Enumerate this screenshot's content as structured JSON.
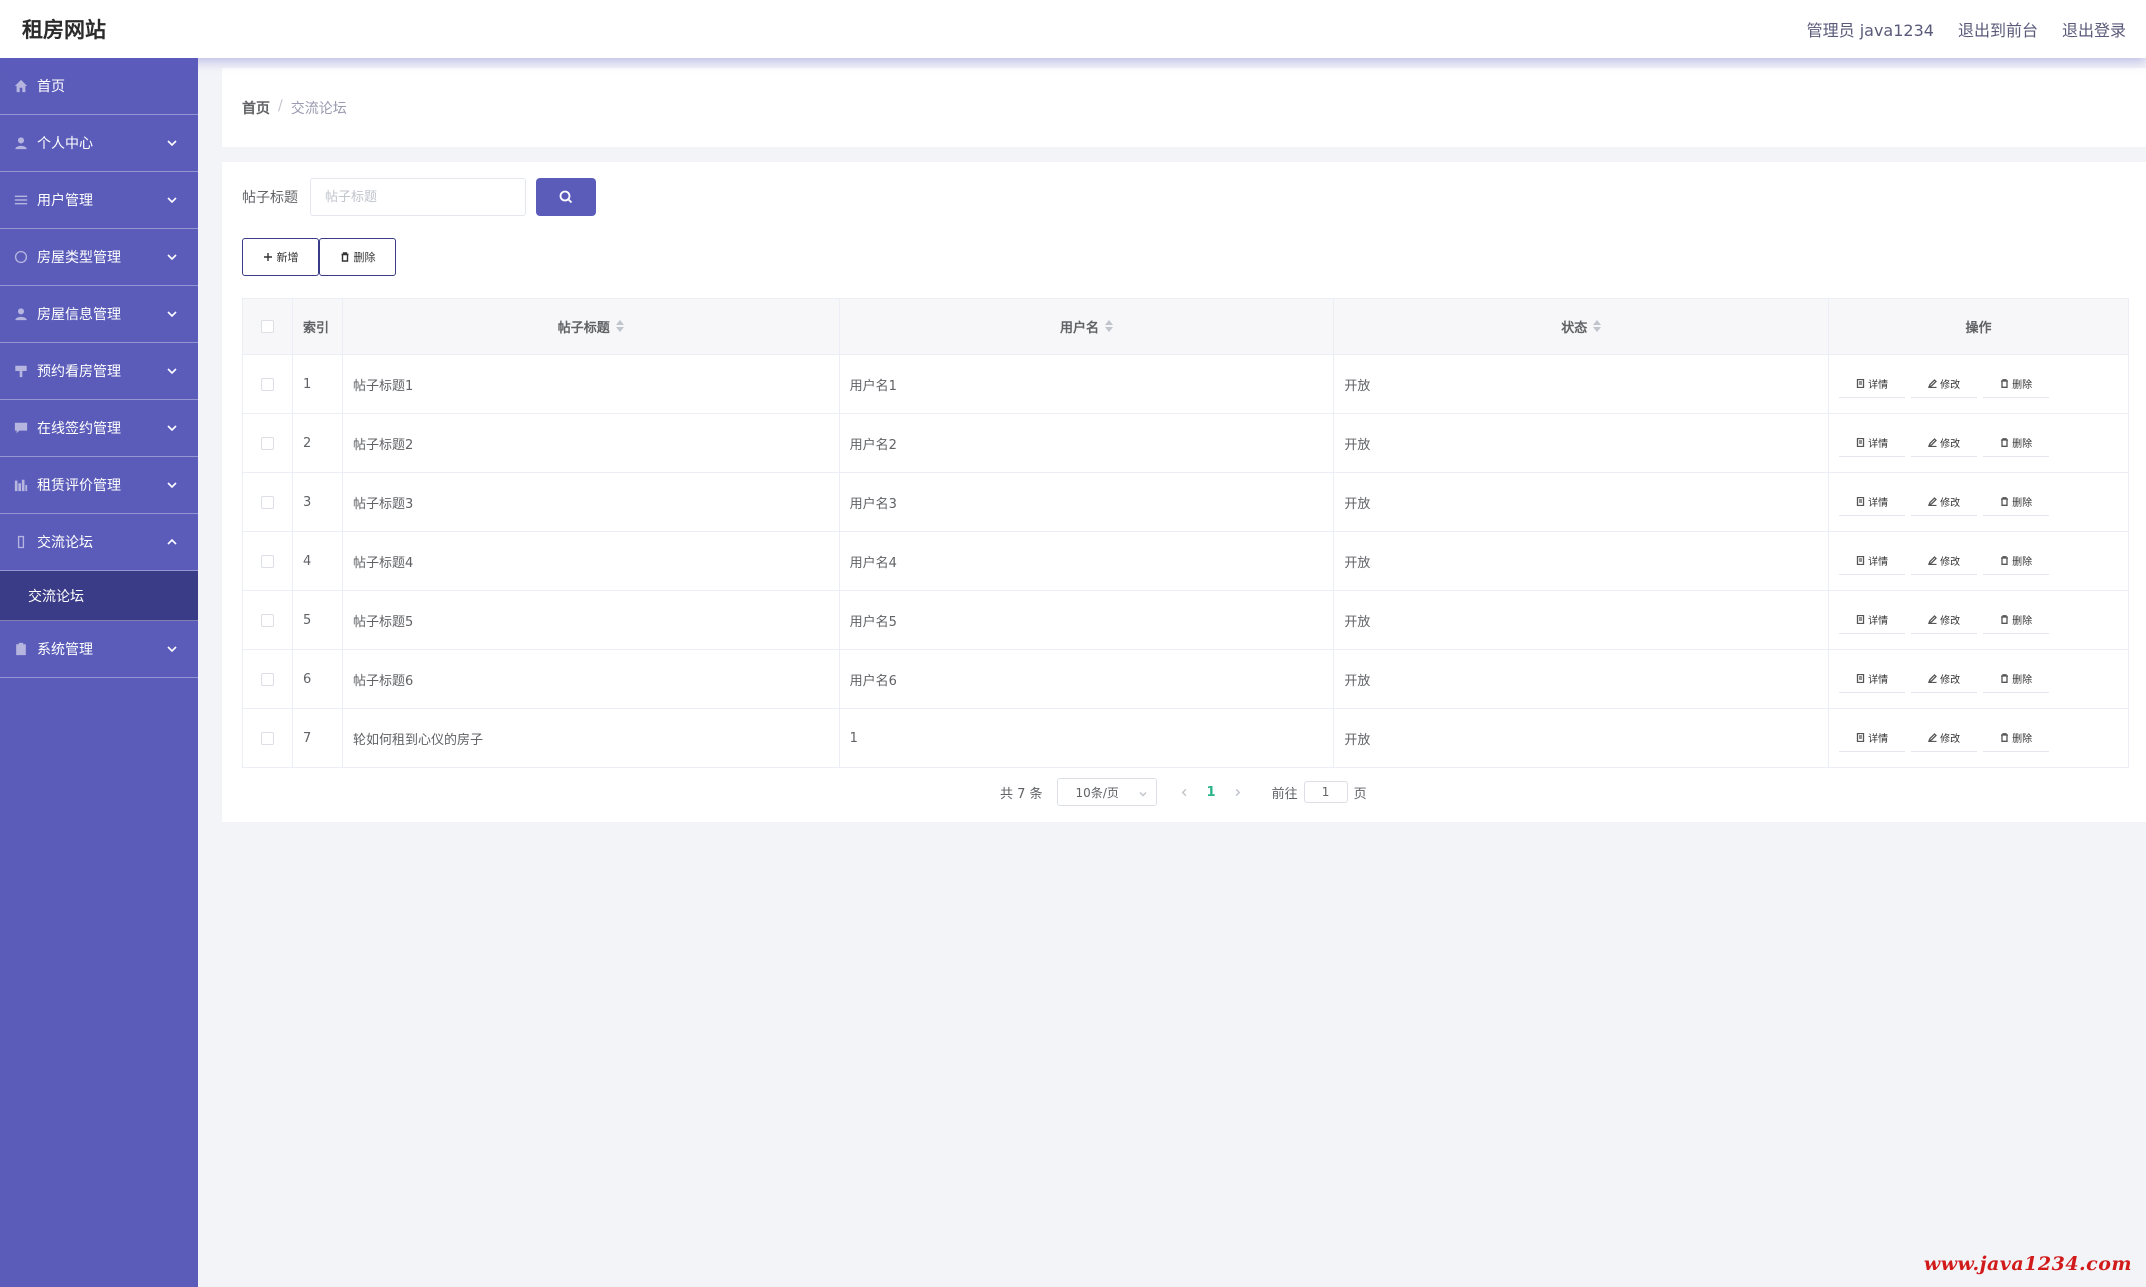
{
  "header": {
    "title": "租房网站",
    "admin_label": "管理员 java1234",
    "front_link": "退出到前台",
    "logout_link": "退出登录"
  },
  "sidebar": {
    "items": [
      {
        "label": "首页",
        "icon": "home-icon"
      },
      {
        "label": "个人中心",
        "icon": "user-icon"
      },
      {
        "label": "用户管理",
        "icon": "sliders-icon"
      },
      {
        "label": "房屋类型管理",
        "icon": "globe-icon"
      },
      {
        "label": "房屋信息管理",
        "icon": "user-icon"
      },
      {
        "label": "预约看房管理",
        "icon": "stand-icon"
      },
      {
        "label": "在线签约管理",
        "icon": "message-icon"
      },
      {
        "label": "租赁评价管理",
        "icon": "chart-icon"
      },
      {
        "label": "交流论坛",
        "icon": "phone-icon"
      },
      {
        "label": "系统管理",
        "icon": "clipboard-icon"
      }
    ],
    "active_sub": "交流论坛"
  },
  "breadcrumb": {
    "home": "首页",
    "separator": "/",
    "current": "交流论坛"
  },
  "search": {
    "label": "帖子标题",
    "placeholder": "帖子标题"
  },
  "actions": {
    "add_label": "新增",
    "delete_label": "删除"
  },
  "table": {
    "headers": {
      "index": "索引",
      "title": "帖子标题",
      "username": "用户名",
      "status": "状态",
      "ops": "操作"
    },
    "rows": [
      {
        "index": "1",
        "title": "帖子标题1",
        "username": "用户名1",
        "status": "开放"
      },
      {
        "index": "2",
        "title": "帖子标题2",
        "username": "用户名2",
        "status": "开放"
      },
      {
        "index": "3",
        "title": "帖子标题3",
        "username": "用户名3",
        "status": "开放"
      },
      {
        "index": "4",
        "title": "帖子标题4",
        "username": "用户名4",
        "status": "开放"
      },
      {
        "index": "5",
        "title": "帖子标题5",
        "username": "用户名5",
        "status": "开放"
      },
      {
        "index": "6",
        "title": "帖子标题6",
        "username": "用户名6",
        "status": "开放"
      },
      {
        "index": "7",
        "title": "轮如何租到心仪的房子",
        "username": "1",
        "status": "开放"
      }
    ],
    "op_labels": {
      "detail": "详情",
      "edit": "修改",
      "delete": "删除"
    }
  },
  "pagination": {
    "total": "共 7 条",
    "page_size": "10条/页",
    "current_page": "1",
    "goto_prefix": "前往",
    "goto_value": "1",
    "goto_suffix": "页"
  },
  "watermark": "www.java1234.com",
  "colors": {
    "sidebar": "#5b5cba",
    "sidebar_active": "#3b3c88",
    "primary": "#5b5cba",
    "page_active": "#2ab48a"
  }
}
